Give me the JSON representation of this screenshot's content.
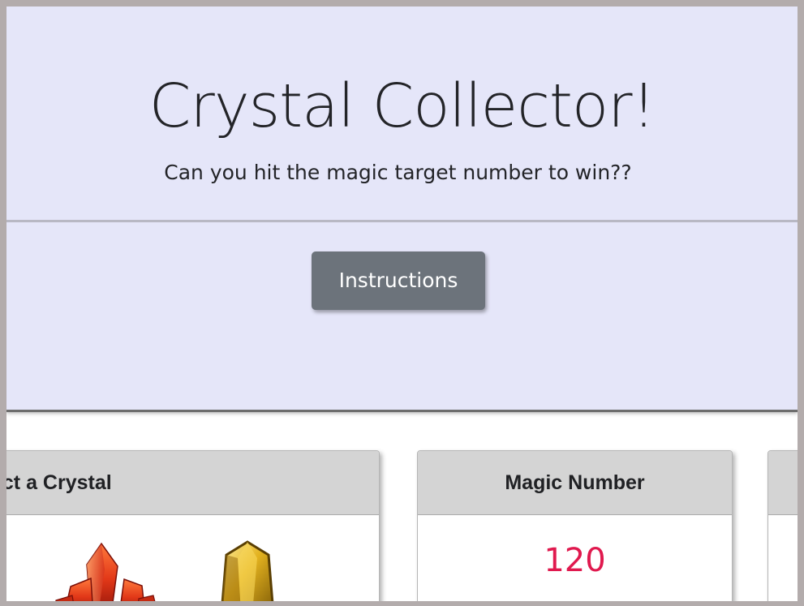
{
  "header": {
    "title": "Crystal Collector!",
    "subtitle": "Can you hit the magic target number to win??",
    "instructions_label": "Instructions"
  },
  "cards": {
    "crystals": {
      "header": "Select a Crystal",
      "visible_header": "ect a Crystal",
      "crystal_icons": [
        "red-crystal-icon",
        "gold-crystal-icon"
      ]
    },
    "magic": {
      "header": "Magic Number",
      "value": "120"
    }
  },
  "colors": {
    "jumbotron_bg": "#e5e6f9",
    "button_bg": "#6c737b",
    "magic_value": "#e0194e",
    "card_header_bg": "#d4d4d4"
  }
}
